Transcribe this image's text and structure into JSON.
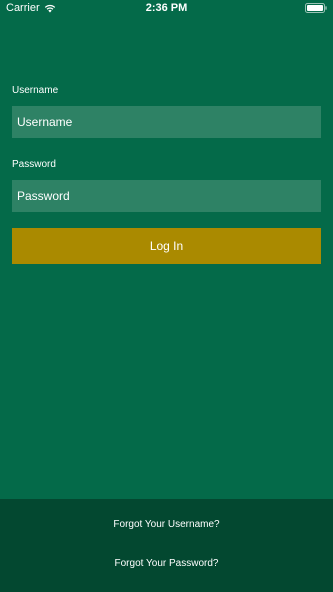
{
  "status_bar": {
    "carrier": "Carrier",
    "time": "2:36 PM",
    "wifi_icon": "wifi-icon",
    "battery_icon": "battery-icon"
  },
  "login_form": {
    "username_label": "Username",
    "username_placeholder": "Username",
    "password_label": "Password",
    "password_placeholder": "Password",
    "login_button": "Log In"
  },
  "footer": {
    "forgot_username": "Forgot Your Username?",
    "forgot_password": "Forgot Your Password?"
  },
  "colors": {
    "background": "#046a49",
    "input_background": "#2e8265",
    "button": "#aa8a00",
    "footer": "#034830",
    "text": "#ffffff"
  }
}
